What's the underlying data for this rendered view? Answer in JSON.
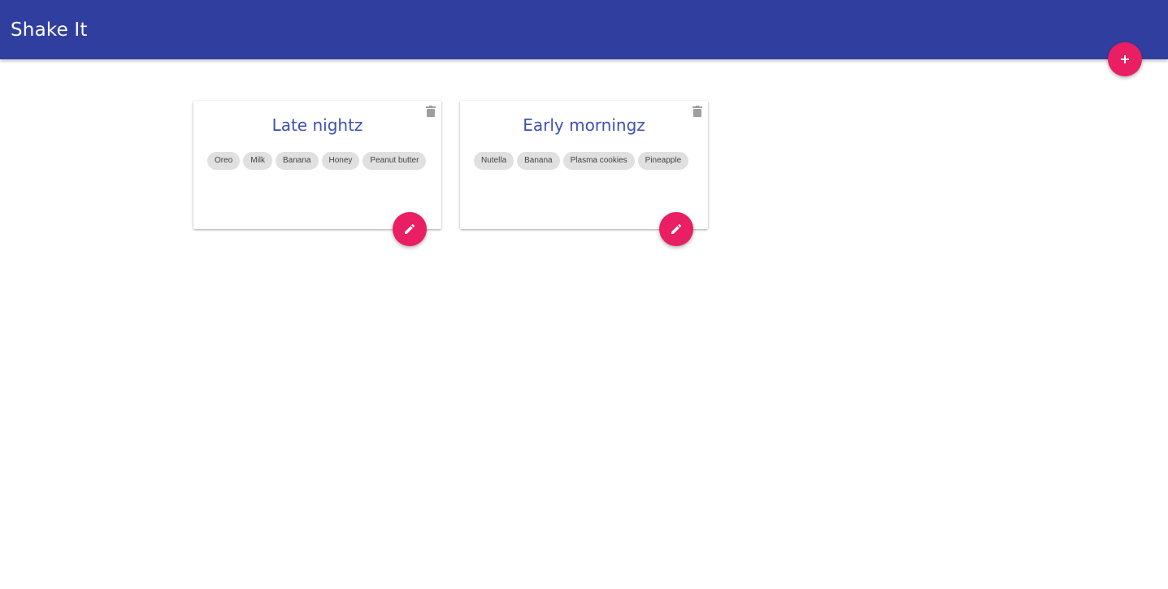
{
  "app": {
    "title": "Shake It",
    "add_icon": "plus-icon",
    "colors": {
      "primary": "#303f9f",
      "accent": "#e91e63",
      "card_title": "#3f51b5",
      "chip_bg": "#e0e0e0"
    }
  },
  "cards": [
    {
      "title": "Late nightz",
      "delete_icon": "trash-icon",
      "edit_icon": "pencil-icon",
      "ingredients": [
        "Oreo",
        "Milk",
        "Banana",
        "Honey",
        "Peanut butter"
      ]
    },
    {
      "title": "Early morningz",
      "delete_icon": "trash-icon",
      "edit_icon": "pencil-icon",
      "ingredients": [
        "Nutella",
        "Banana",
        "Plasma cookies",
        "Pineapple"
      ]
    }
  ]
}
